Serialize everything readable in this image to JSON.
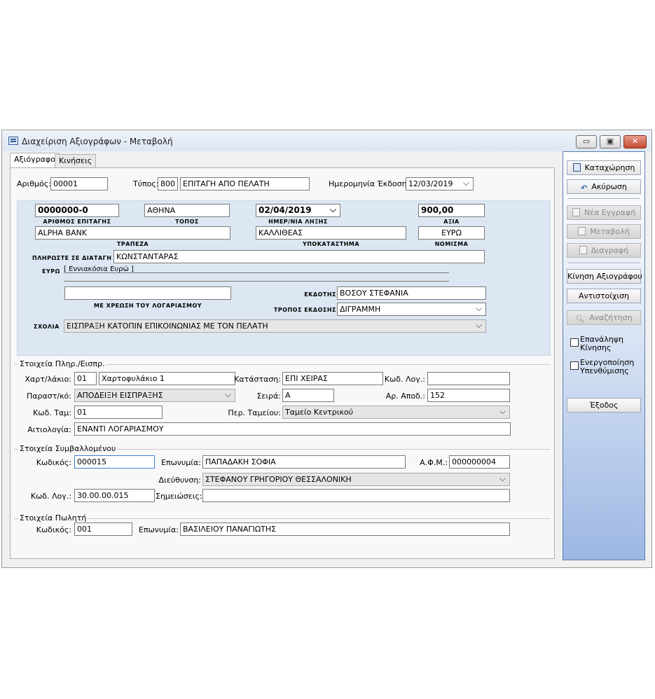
{
  "window": {
    "title": "Διαχείριση Αξιογράφων - Μεταβολή",
    "minimize": "▭",
    "maximize": "▣",
    "close": "✕"
  },
  "tabs": [
    "Αξιόγραφο",
    "Κινήσεις"
  ],
  "header": {
    "number_label": "Αριθμός:",
    "number_value": "00001",
    "type_label": "Τύπος:",
    "type_code": "800",
    "type_name": "ΕΠΙΤΑΓΗ ΑΠΟ ΠΕΛΑΤΗ",
    "issue_date_label": "Ημερομηνία Έκδοσης:",
    "issue_date_value": "12/03/2019"
  },
  "cheque": {
    "number_value": "0000000-0",
    "number_label": "ΑΡΙΘΜΟΣ ΕΠΙΤΑΓΗΣ",
    "place_value": "ΑΘΗΝΑ",
    "place_label": "ΤΟΠΟΣ",
    "due_date_value": "02/04/2019",
    "due_date_label": "ΗΜΕΡ/ΝΙΑ ΛΗΞΗΣ",
    "amount_value": "900,00",
    "amount_label": "ΑΞΙΑ",
    "bank_value": "ALPHA BANK",
    "bank_label": "ΤΡΑΠΕΖΑ",
    "branch_value": "ΚΑΛΛΙΘΕΑΣ",
    "branch_label": "ΥΠΟΚΑΤΑΣΤΗΜΑ",
    "currency_value": "ΕΥΡΩ",
    "currency_label": "ΝΟΜΙΣΜΑ",
    "pay_to_label": "ΠΛΗΡΩΣΤΕ ΣΕ ΔΙΑΤΑΓΗ",
    "pay_to_value": "ΚΩΝΣΤΑΝΤΑΡΑΣ",
    "euro_label": "ΕΥΡΩ",
    "amount_words": "[ Εννιακόσια Ευρώ ]",
    "debit_account_value": "",
    "debit_account_label": "ΜΕ ΧΡΕΩΣΗ ΤΟΥ ΛΟΓΑΡΙΑΣΜΟΥ",
    "issuer_label": "ΕΚΔΟΤΗΣ",
    "issuer_value": "ΒΟΣΟΥ ΣΤΕΦΑΝΙΑ",
    "issue_mode_label": "ΤΡΟΠΟΣ ΕΚΔΟΣΗΣ",
    "issue_mode_value": "ΔΙΓΡΑΜΜΗ",
    "comments_label": "ΣΧΟΛΙΑ",
    "comments_value": "ΕΙΣΠΡΑΞΗ ΚΑΤΟΠΙΝ ΕΠΙΚΟΙΝΩΝΙΑΣ ΜΕ ΤΟΝ ΠΕΛΑΤΗ"
  },
  "payment": {
    "title": "Στοιχεία Πληρ./Εισπρ.",
    "portfolio_label": "Χαρτ/λάκιο:",
    "portfolio_code": "01",
    "portfolio_name": "Χαρτοφυλάκιο 1",
    "status_label": "Κατάσταση:",
    "status_value": "ΕΠΙ ΧΕΙΡΑΣ",
    "account_code_label": "Κωδ. Λογ.:",
    "account_code_value": "",
    "document_label": "Παραστ/κό:",
    "document_value": "ΑΠΟΔΕΙΞΗ ΕΙΣΠΡΑΞΗΣ",
    "series_label": "Σειρά:",
    "series_value": "A",
    "receipt_no_label": "Αρ. Αποδ.:",
    "receipt_no_value": "152",
    "cashier_code_label": "Κωδ. Ταμ:",
    "cashier_code_value": "01",
    "cashier_desc_label": "Περ. Ταμείου:",
    "cashier_desc_value": "Ταμείο Κεντρικού",
    "reason_label": "Αιτιολογία:",
    "reason_value": "ΕΝΑΝΤΙ ΛΟΓΑΡΙΑΣΜΟΥ"
  },
  "contractor": {
    "title": "Στοιχεία Συμβαλλομένου",
    "code_label": "Κωδικός:",
    "code_value": "000015",
    "name_label": "Επωνυμία:",
    "name_value": "ΠΑΠΑΔΑΚΗ ΣΟΦΙΑ",
    "vat_label": "Α.Φ.Μ.:",
    "vat_value": "000000004",
    "address_label": "Διεύθυνση:",
    "address_value": "ΣΤΕΦΑΝΟΥ ΓΡΗΓΟΡΙΟΥ ΘΕΣΣΑΛΟΝΙΚΗ",
    "account_label": "Κωδ. Λογ.:",
    "account_value": "30.00.00.015",
    "notes_label": "Σημειώσεις:",
    "notes_value": ""
  },
  "seller": {
    "title": "Στοιχεία Πωλητή",
    "code_label": "Κωδικός:",
    "code_value": "001",
    "name_label": "Επωνυμία:",
    "name_value": "ΒΑΣΙΛΕΙΟΥ ΠΑΝΑΓΙΩΤΗΣ"
  },
  "actions": {
    "save": "Καταχώρηση",
    "cancel": "Ακύρωση",
    "new_record": "Νέα Εγγραφή",
    "modify": "Μεταβολή",
    "delete": "Διαγραφή",
    "movement": "Κίνηση Αξιογράφου",
    "matching": "Αντιστοίχιση",
    "search": "Αναζήτηση",
    "repeat_movement": "Επανάληψη Κίνησης",
    "enable_reminder": "Ενεργοποίηση Υπενθύμισης",
    "exit": "Έξοδος"
  }
}
